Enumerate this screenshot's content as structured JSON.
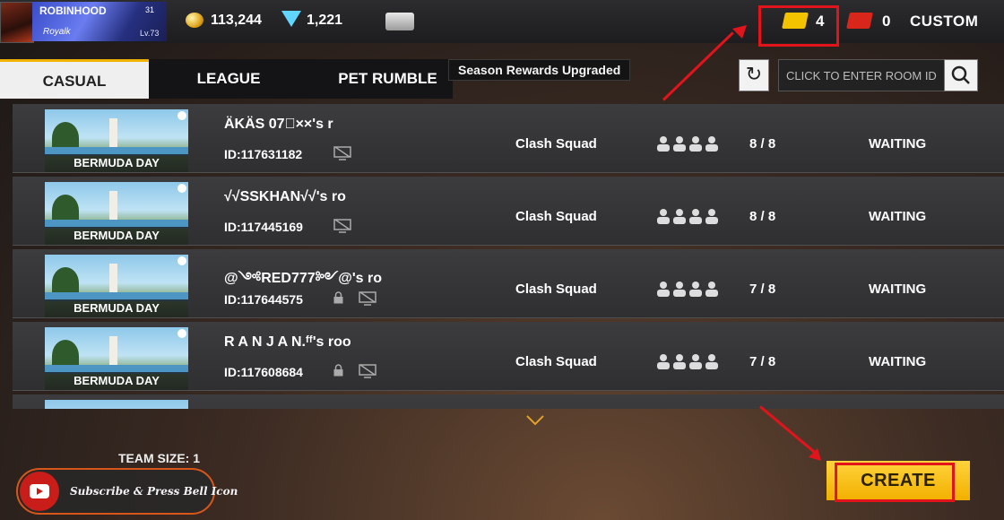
{
  "player": {
    "name": "ROBINHOOD",
    "guild": "Royalk",
    "level": "Lv.73",
    "rank": "31"
  },
  "currency": {
    "gold": "113,244",
    "diamonds": "1,221"
  },
  "tickets": {
    "room_card_count": "4",
    "red_card_count": "0"
  },
  "header": {
    "custom_label": "CUSTOM"
  },
  "tabs": [
    {
      "label": "CASUAL",
      "active": true
    },
    {
      "label": "LEAGUE",
      "active": false
    },
    {
      "label": "PET RUMBLE",
      "active": false
    }
  ],
  "season_badge": "Season Rewards Upgraded",
  "search": {
    "placeholder": "CLICK TO ENTER ROOM ID"
  },
  "rooms": [
    {
      "map": "BERMUDA DAY",
      "name": "ÄKÄS  07⃝××'s r",
      "id": "ID:117631182",
      "locked": false,
      "mode": "Clash Squad",
      "players": "8 / 8",
      "status": "WAITING"
    },
    {
      "map": "BERMUDA DAY",
      "name": "√√SSKHAN√√'s ro",
      "id": "ID:117445169",
      "locked": false,
      "mode": "Clash Squad",
      "players": "8 / 8",
      "status": "WAITING"
    },
    {
      "map": "BERMUDA DAY",
      "name": "@༺RED777༻@'s ro",
      "id": "ID:117644575",
      "locked": true,
      "mode": "Clash Squad",
      "players": "7 / 8",
      "status": "WAITING"
    },
    {
      "map": "BERMUDA DAY",
      "name": "R A N J A N.ᶠᶠ's roo",
      "id": "ID:117608684",
      "locked": true,
      "mode": "Clash Squad",
      "players": "7 / 8",
      "status": "WAITING"
    }
  ],
  "footer": {
    "team_size": "TEAM SIZE: 1",
    "create_label": "CREATE",
    "subscribe_text": "Subscribe & Press Bell Icon"
  },
  "colors": {
    "accent_yellow": "#f2b000",
    "highlight_red": "#e2141b",
    "tab_active_bg": "#efefef"
  }
}
